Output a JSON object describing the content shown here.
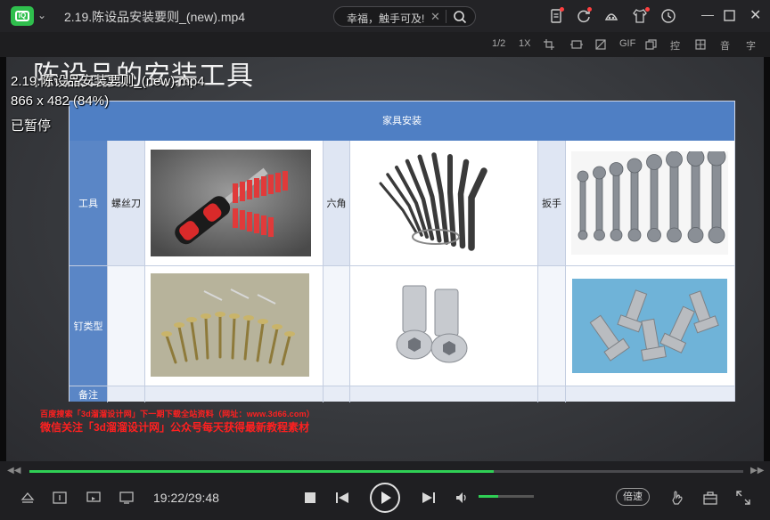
{
  "app": {
    "title": "2.19.陈设品安装要则_(new).mp4"
  },
  "search": {
    "value": "幸福，触手可及!"
  },
  "toolbar": {
    "items": [
      "1/2",
      "1X",
      "GIF",
      "控",
      "音",
      "字"
    ]
  },
  "video": {
    "osd_lines": [
      "2.19.陈设品安装要则_(new).mp4",
      "866 x 482 (84%)",
      "已暂停"
    ],
    "slide_title": "陈设品的安装工具",
    "table": {
      "header": "家具安装",
      "row_tools": "工具",
      "row_nails": "钉类型",
      "row_notes": "备注",
      "label_screwdriver": "螺丝刀",
      "label_hex": "六角",
      "label_wrench": "扳手"
    },
    "watermark_line1": "百度搜索「3d溜溜设计网」下一期下载全站资料（网址：www.3d66.com）",
    "watermark_line2": "微信关注「3d溜溜设计网」公众号每天获得最新教程素材"
  },
  "player": {
    "time": "19:22/29:48",
    "progress": 0.65,
    "volume": 0.35,
    "speed_label": "倍速",
    "accent": "#2fcf55"
  }
}
